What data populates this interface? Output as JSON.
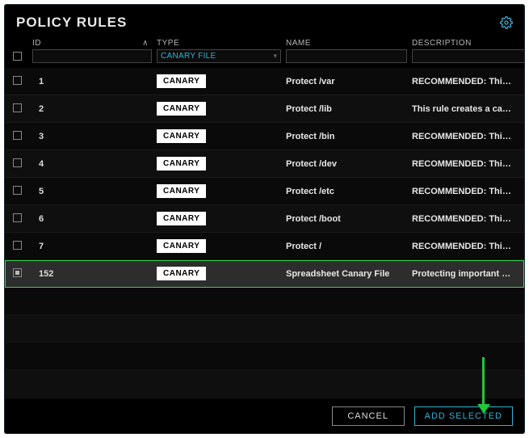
{
  "header": {
    "title": "POLICY RULES"
  },
  "columns": {
    "id_label": "ID",
    "type_label": "TYPE",
    "name_label": "NAME",
    "desc_label": "DESCRIPTION"
  },
  "filters": {
    "id_value": "",
    "type_selected": "CANARY FILE",
    "name_value": "",
    "desc_value": ""
  },
  "badge_text": "CANARY",
  "rows": [
    {
      "id": "1",
      "name": "Protect /var",
      "desc": "RECOMMENDED: This rule cr…",
      "selected": false
    },
    {
      "id": "2",
      "name": "Protect /lib",
      "desc": "This rule creates a canary fil…",
      "selected": false
    },
    {
      "id": "3",
      "name": "Protect /bin",
      "desc": "RECOMMENDED: This rule cr…",
      "selected": false
    },
    {
      "id": "4",
      "name": "Protect /dev",
      "desc": "RECOMMENDED: This rule cr…",
      "selected": false
    },
    {
      "id": "5",
      "name": "Protect /etc",
      "desc": "RECOMMENDED: This rule cr…",
      "selected": false
    },
    {
      "id": "6",
      "name": "Protect /boot",
      "desc": "RECOMMENDED: This rule cr…",
      "selected": false
    },
    {
      "id": "7",
      "name": "Protect /",
      "desc": "RECOMMENDED: This rule cr…",
      "selected": false
    },
    {
      "id": "152",
      "name": "Spreadsheet Canary File",
      "desc": "Protecting important sprea…",
      "selected": true
    }
  ],
  "footer": {
    "cancel_label": "CANCEL",
    "add_label": "ADD SELECTED"
  },
  "colors": {
    "accent_cyan": "#2fb2d4",
    "accent_green": "#22c73a"
  }
}
